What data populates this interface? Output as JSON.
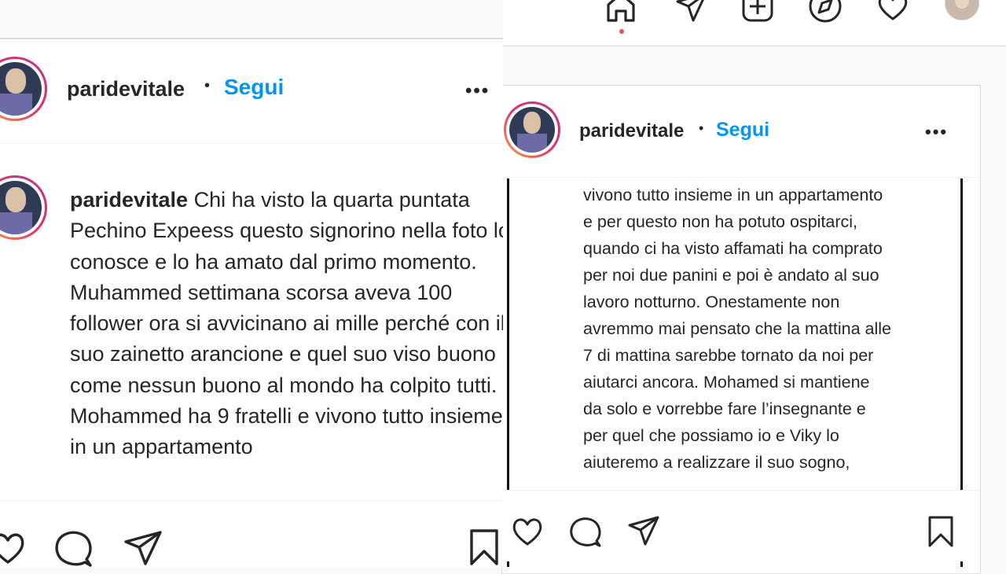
{
  "post": {
    "username": "paridevitale",
    "separator": "•",
    "follow_label": "Segui",
    "more_label": "•••"
  },
  "left": {
    "caption_user": "paridevitale",
    "caption_text": " Chi ha visto la quarta puntata Pechino Expeess questo signorino nella foto lo conosce e lo ha amato dal primo momento. Muhammed settimana scorsa aveva 100 follower ora si avvicinano ai mille perché con il suo zainetto arancione e quel suo viso buono come nessun buono al mondo ha colpito tutti. Mohammed ha 9 fratelli e vivono tutto insieme in un appartamento"
  },
  "right": {
    "caption_text": "vivono tutto insieme in un appartamento\ne per questo non ha potuto ospitarci,\nquando ci ha visto affamati ha comprato\nper noi due panini e poi è andato al suo\nlavoro notturno. Onestamente non\navremmo mai pensato che la mattina alle\n7 di mattina sarebbe tornato da noi per\naiutarci ancora. Mohamed si mantiene\nda solo e vorrebbe fare l’insegnante e\nper quel che possiamo io e Viky lo\naiuteremo a realizzare il suo sogno,"
  },
  "nav": {
    "icons": [
      "home-icon",
      "direct-icon",
      "new-post-icon",
      "explore-icon",
      "activity-icon",
      "profile-avatar"
    ]
  },
  "actions": [
    "like-icon",
    "comment-icon",
    "share-icon",
    "save-icon"
  ],
  "colors": {
    "follow": "#0095f6",
    "text": "#262626",
    "notification_dot": "#ed4956",
    "story_ring_start": "#f9a03f",
    "story_ring_end": "#c13584"
  }
}
